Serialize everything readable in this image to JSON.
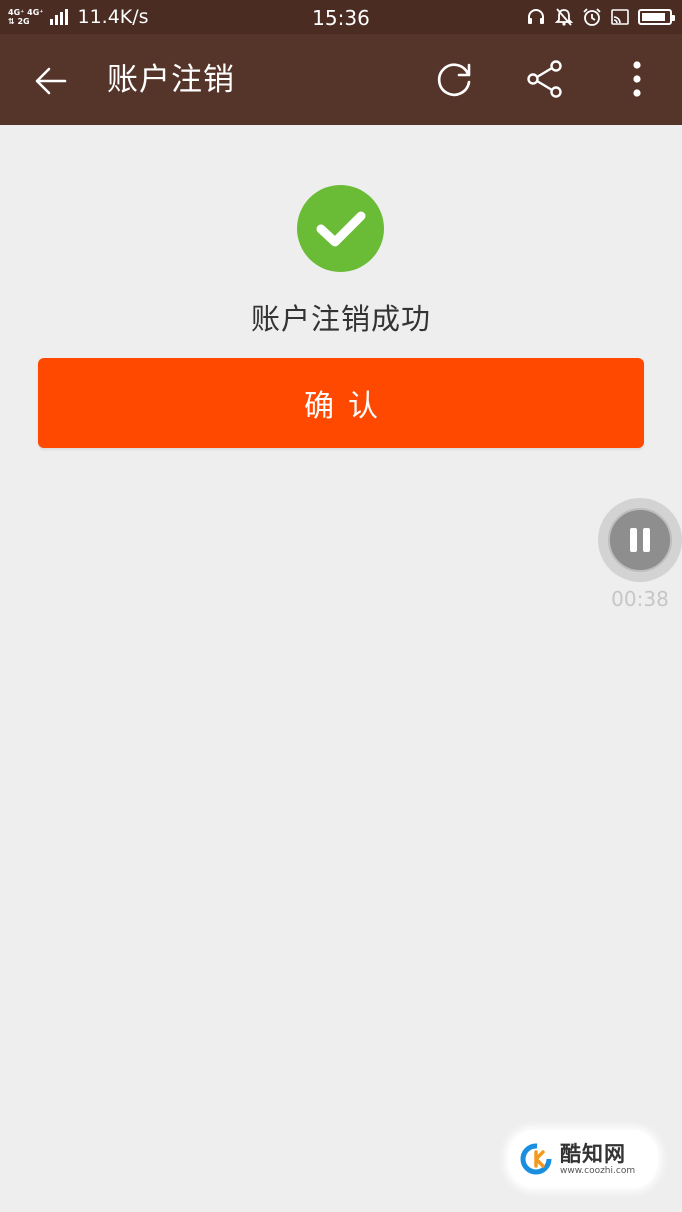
{
  "status_bar": {
    "net_top": "4G⁺ 4G⁺",
    "net_bottom": "⇅ 2G",
    "speed": "11.4K/s",
    "time": "15:36",
    "icons": [
      "headset-icon",
      "notification-off-icon",
      "alarm-icon",
      "cast-icon",
      "battery-icon"
    ],
    "battery_level": 0.9
  },
  "app_bar": {
    "title": "账户注销",
    "background": "#55342a",
    "icons": [
      "back-arrow-icon",
      "refresh-icon",
      "share-icon",
      "more-vert-icon"
    ]
  },
  "main": {
    "success_icon": "check-circle-icon",
    "success_color": "#6abb35",
    "message": "账户注销成功",
    "confirm_label": "确认",
    "confirm_color": "#ff4800"
  },
  "recorder": {
    "icon": "pause-icon",
    "elapsed": "00:38"
  },
  "watermark": {
    "name": "酷知网",
    "url": "www.coozhi.com"
  }
}
